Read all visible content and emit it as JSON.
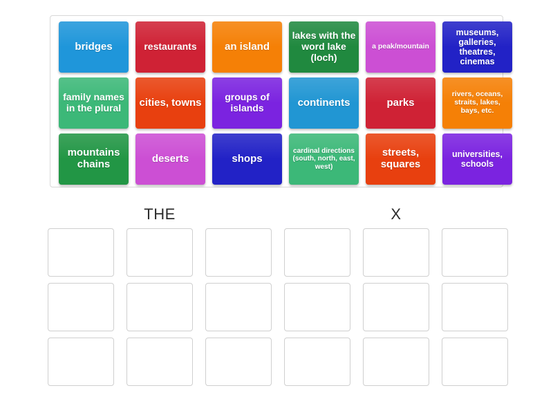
{
  "word_bank": {
    "rows": [
      [
        {
          "label": "bridges",
          "color": "#1f96da",
          "size": "fs-15"
        },
        {
          "label": "restaurants",
          "color": "#cf2235",
          "size": "fs-14"
        },
        {
          "label": "an island",
          "color": "#f58006",
          "size": "fs-15"
        },
        {
          "label": "lakes with the word lake (loch)",
          "color": "#20893f",
          "size": "fs-14"
        },
        {
          "label": "a peak/mountain",
          "color": "#cc4fd4",
          "size": "fs-11"
        },
        {
          "label": "museums, galleries, theatres, cinemas",
          "color": "#2222c6",
          "size": "fs-13"
        }
      ],
      [
        {
          "label": "family names in the plural",
          "color": "#3cb878",
          "size": "fs-14"
        },
        {
          "label": "cities, towns",
          "color": "#e8400f",
          "size": "fs-15"
        },
        {
          "label": "groups of islands",
          "color": "#7b23e0",
          "size": "fs-14"
        },
        {
          "label": "continents",
          "color": "#2196d3",
          "size": "fs-15"
        },
        {
          "label": "parks",
          "color": "#cf2235",
          "size": "fs-15"
        },
        {
          "label": "rivers, oceans, straits, lakes, bays, etc.",
          "color": "#f58006",
          "size": "fs-11"
        }
      ],
      [
        {
          "label": "mountains chains",
          "color": "#229645",
          "size": "fs-15"
        },
        {
          "label": "deserts",
          "color": "#cc4fd4",
          "size": "fs-15"
        },
        {
          "label": "shops",
          "color": "#2222c6",
          "size": "fs-15"
        },
        {
          "label": "cardinal directions (south, north, east, west)",
          "color": "#3cb878",
          "size": "fs-10"
        },
        {
          "label": "streets, squares",
          "color": "#e8400f",
          "size": "fs-15"
        },
        {
          "label": "universities, schools",
          "color": "#7b23e0",
          "size": "fs-13"
        }
      ]
    ]
  },
  "groups": [
    {
      "title": "THE",
      "slots": [
        "",
        "",
        "",
        "",
        "",
        "",
        "",
        "",
        ""
      ]
    },
    {
      "title": "X",
      "slots": [
        "",
        "",
        "",
        "",
        "",
        "",
        "",
        "",
        ""
      ]
    }
  ]
}
